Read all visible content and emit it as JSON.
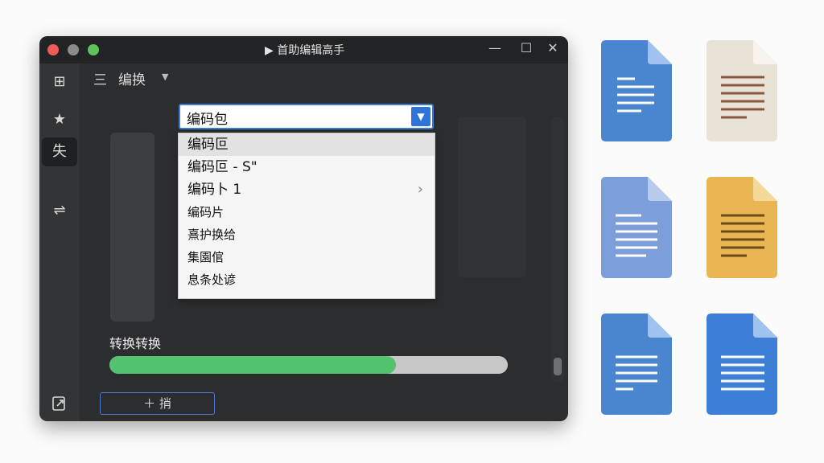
{
  "window": {
    "title": "▶ 首助编辑高手",
    "controls": {
      "minimize": "—",
      "maximize": "☐",
      "close": "✕"
    }
  },
  "sidebar": {
    "items": [
      {
        "icon": "grid-icon",
        "glyph": "⊞"
      },
      {
        "icon": "star-icon",
        "glyph": "★"
      },
      {
        "label": "失"
      },
      {
        "icon": "convert-icon",
        "glyph": "⇌"
      }
    ],
    "bottom_icon": "export-icon"
  },
  "toolbar": {
    "menu_glyph": "三",
    "label": "编换"
  },
  "select": {
    "value": "编码包",
    "options": [
      {
        "label": "编码叵",
        "selected": true
      },
      {
        "label": "编码叵 - S\""
      },
      {
        "label": "编码卜 1",
        "submenu": true
      },
      {
        "label": "编码片"
      },
      {
        "label": "熹护换给"
      },
      {
        "label": "集園倌"
      },
      {
        "label": "息条处谚"
      }
    ]
  },
  "progress": {
    "label": "转换转换",
    "percent": 72
  },
  "add_button": {
    "label": "＋ 捎"
  },
  "file_icons": [
    {
      "name": "document-blue-icon",
      "color": "#4a86d0"
    },
    {
      "name": "document-beige-icon",
      "color": "#e9e2d6"
    },
    {
      "name": "document-lightblue-icon",
      "color": "#7c9edb"
    },
    {
      "name": "document-yellow-icon",
      "color": "#eab653"
    },
    {
      "name": "document-blue-2-icon",
      "color": "#4a86d0"
    },
    {
      "name": "document-blue-3-icon",
      "color": "#3d7fd6"
    }
  ]
}
